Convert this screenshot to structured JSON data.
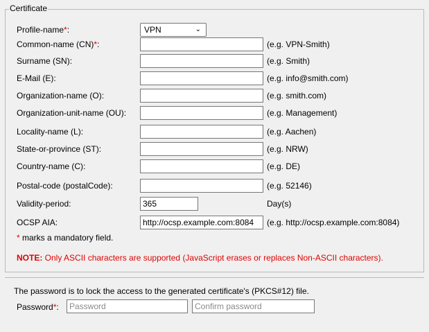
{
  "fieldset": {
    "legend": "Certificate"
  },
  "required_marker": "*",
  "fields": [
    {
      "label": "Profile-name",
      "required": true,
      "colon": ":",
      "type": "select",
      "value": "VPN",
      "hint": ""
    },
    {
      "label": "Common-name (CN)",
      "required": true,
      "colon": ":",
      "type": "text",
      "value": "",
      "hint": "(e.g. VPN-Smith)"
    },
    {
      "label": "Surname (SN):",
      "required": false,
      "type": "text",
      "value": "",
      "hint": "(e.g. Smith)"
    },
    {
      "label": "E-Mail (E):",
      "required": false,
      "type": "text",
      "value": "",
      "hint": "(e.g. info@smith.com)"
    },
    {
      "label": "Organization-name (O):",
      "required": false,
      "type": "text",
      "value": "",
      "hint": "(e.g. smith.com)"
    },
    {
      "label": "Organization-unit-name (OU):",
      "required": false,
      "type": "text",
      "value": "",
      "hint": "(e.g. Management)"
    },
    {
      "label": "Locality-name (L):",
      "required": false,
      "type": "text",
      "value": "",
      "hint": "(e.g. Aachen)"
    },
    {
      "label": "State-or-province (ST):",
      "required": false,
      "type": "text",
      "value": "",
      "hint": "(e.g. NRW)"
    },
    {
      "label": "Country-name (C):",
      "required": false,
      "type": "text",
      "value": "",
      "hint": "(e.g. DE)"
    },
    {
      "label": "Postal-code (postalCode):",
      "required": false,
      "type": "text",
      "value": "",
      "hint": "(e.g. 52146)"
    },
    {
      "label": "Validity-period:",
      "required": false,
      "type": "short",
      "value": "365",
      "hint": "Day(s)"
    },
    {
      "label": "OCSP AIA:",
      "required": false,
      "type": "text",
      "value": "http://ocsp.example.com:8084",
      "hint": "(e.g. http://ocsp.example.com:8084)"
    }
  ],
  "notes": {
    "mandatory": " marks a mandatory field.",
    "note_label": "NOTE:",
    "note_text": " Only ASCII characters are supported (JavaScript erases or replaces Non-ASCII characters)."
  },
  "password": {
    "info": "The password is to lock the access to the generated certificate's (PKCS#12) file.",
    "label": "Password",
    "colon": ":",
    "placeholder": "Password",
    "confirm_placeholder": "Confirm password"
  },
  "colors": {
    "required": "#e00000",
    "background": "#f0f0f0",
    "border": "#b9b9b9"
  }
}
